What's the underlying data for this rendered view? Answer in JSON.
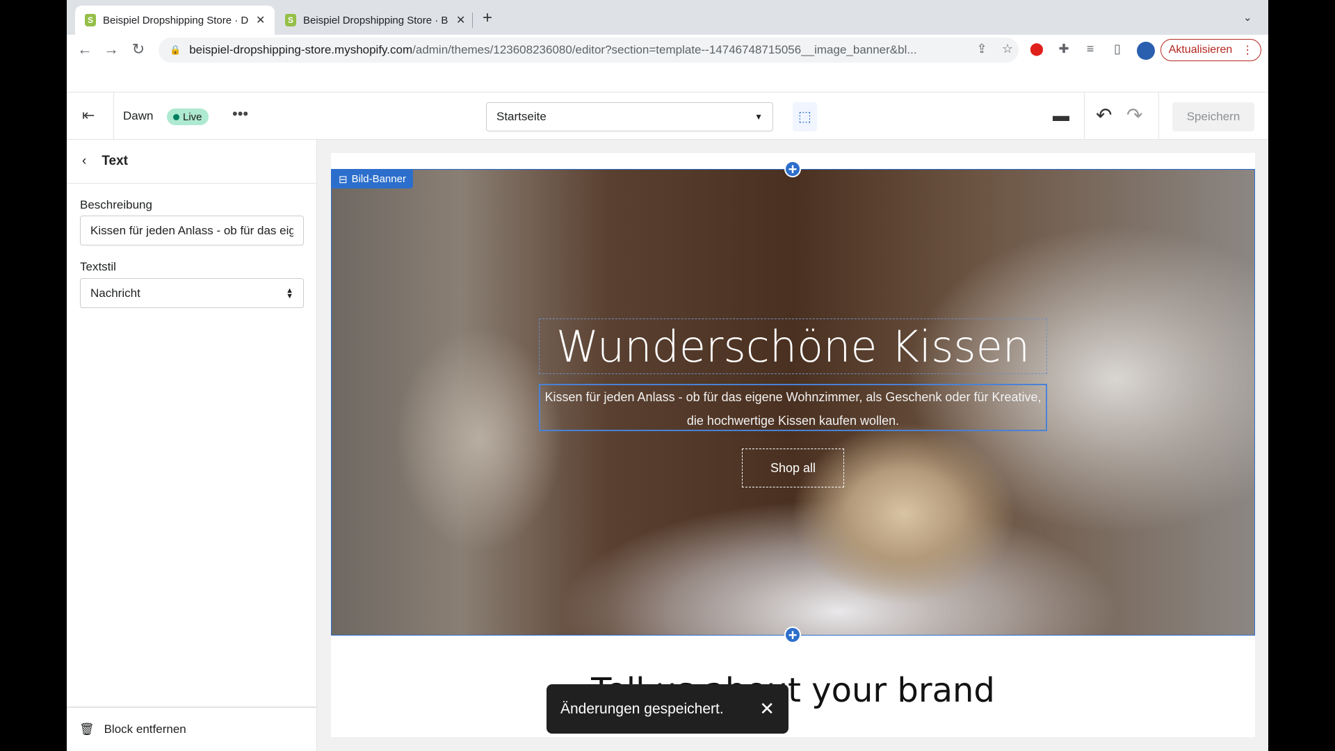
{
  "browser": {
    "tabs": [
      {
        "title": "Beispiel Dropshipping Store · D",
        "active": true
      },
      {
        "title": "Beispiel Dropshipping Store · B",
        "active": false
      }
    ],
    "url_host": "beispiel-dropshipping-store.myshopify.com",
    "url_path": "/admin/themes/123608236080/editor?section=template--14746748715056__image_banner&bl...",
    "update_label": "Aktualisieren"
  },
  "editor": {
    "theme_name": "Dawn",
    "live_badge": "Live",
    "page_select": "Startseite",
    "save_label": "Speichern"
  },
  "sidebar": {
    "title": "Text",
    "description_label": "Beschreibung",
    "description_value": "Kissen für jeden Anlass - ob für das eigene Wohnzimmer, als Geschenk oder für Kreative, die hochwertige Kissen kaufen wollen.",
    "textstyle_label": "Textstil",
    "textstyle_value": "Nachricht",
    "remove_block": "Block entfernen"
  },
  "preview": {
    "section_tag": "Bild-Banner",
    "heading": "Wunderschöne Kissen",
    "description": "Kissen für jeden Anlass - ob für das eigene Wohnzimmer, als Geschenk oder für Kreative, die hochwertige Kissen kaufen wollen.",
    "button": "Shop all",
    "next_heading": "Tell us about your brand"
  },
  "toast": {
    "message": "Änderungen gespeichert."
  }
}
